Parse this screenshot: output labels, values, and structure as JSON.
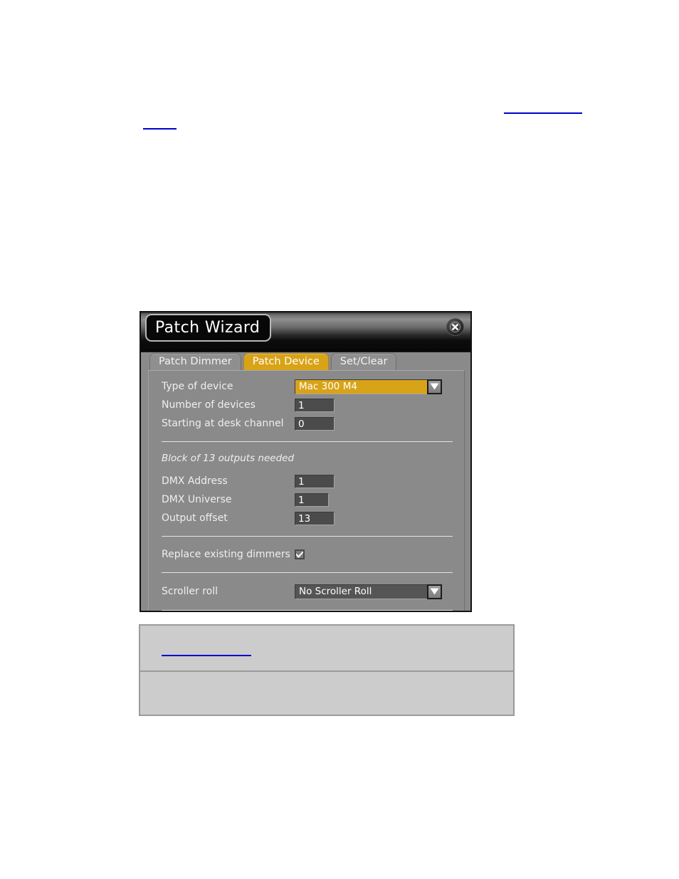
{
  "document": {
    "links": [
      {
        "name": "top-right-link",
        "text": ""
      },
      {
        "name": "top-left-link",
        "text": ""
      }
    ],
    "note_table": {
      "rows": [
        {
          "text": "",
          "link_text": ""
        },
        {
          "text": ""
        }
      ]
    }
  },
  "dialog": {
    "title": "Patch Wizard",
    "close_label": "Close",
    "icons": {
      "close": "close-circle-icon",
      "dropdown": "chevron-down-icon",
      "check": "check-icon"
    },
    "colors": {
      "accent_gold": "#d9a318",
      "panel_gray": "#8a8a8a",
      "field_dark": "#4b4b4b",
      "titlebar_black": "#080808"
    },
    "tabs": [
      {
        "label": "Patch Dimmer",
        "active": false
      },
      {
        "label": "Patch Device",
        "active": true
      },
      {
        "label": "Set/Clear",
        "active": false
      }
    ],
    "form": {
      "type_of_device": {
        "label": "Type of device",
        "value": "Mac 300 M4"
      },
      "number_of_devices": {
        "label": "Number of devices",
        "value": "1"
      },
      "starting_at_desk_channel": {
        "label": "Starting at desk channel",
        "value": "0"
      },
      "block_note": "Block of 13 outputs needed",
      "dmx_address": {
        "label": "DMX Address",
        "value": "1"
      },
      "dmx_universe": {
        "label": "DMX Universe",
        "value": "1"
      },
      "output_offset": {
        "label": "Output offset",
        "value": "13"
      },
      "replace_existing_dimmers": {
        "label": "Replace existing dimmers",
        "checked": true
      },
      "scroller_roll": {
        "label": "Scroller roll",
        "value": "No Scroller Roll"
      }
    }
  }
}
